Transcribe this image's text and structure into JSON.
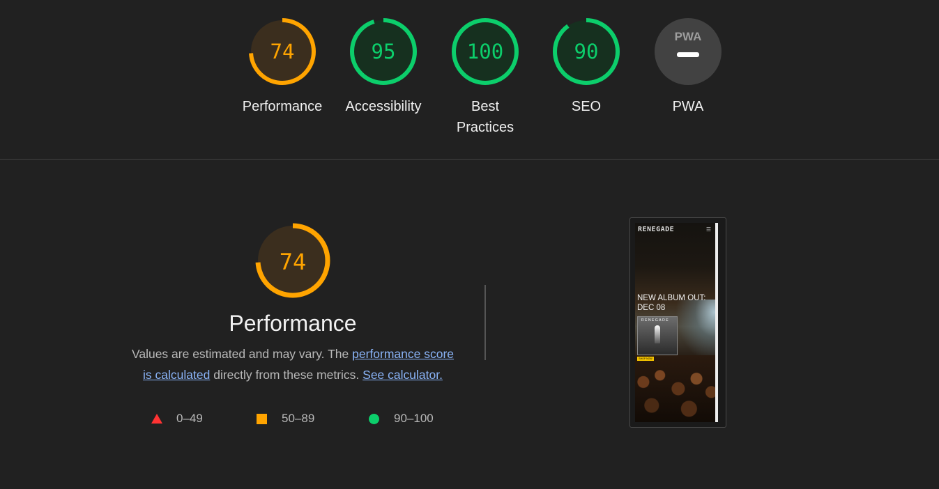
{
  "scores": [
    {
      "id": "performance",
      "value": 74,
      "text": "74",
      "label": "Performance",
      "color": "#ffa400",
      "fraction": 0.74
    },
    {
      "id": "accessibility",
      "value": 95,
      "text": "95",
      "label": "Accessibility",
      "color": "#0cce6b",
      "fraction": 0.95
    },
    {
      "id": "best-practices",
      "value": 100,
      "text": "100",
      "label": "Best Practices",
      "label_line1": "Best",
      "label_line2": "Practices",
      "color": "#0cce6b",
      "fraction": 1.0
    },
    {
      "id": "seo",
      "value": 90,
      "text": "90",
      "label": "SEO",
      "color": "#0cce6b",
      "fraction": 0.9
    },
    {
      "id": "pwa",
      "value": null,
      "badge": "PWA",
      "label": "PWA",
      "color": "#9e9e9e"
    }
  ],
  "performance_section": {
    "score": 74,
    "score_text": "74",
    "fraction": 0.74,
    "title": "Performance",
    "desc_prefix": "Values are estimated and may vary. The ",
    "link1_line1": "performance score",
    "link1_line2": "is calculated",
    "desc_middle": " directly from these metrics. ",
    "link2": "See calculator."
  },
  "legend": [
    {
      "shape": "triangle",
      "color": "#ff3333",
      "range": "0–49"
    },
    {
      "shape": "square",
      "color": "#ffa400",
      "range": "50–89"
    },
    {
      "shape": "circle",
      "color": "#0cce6b",
      "range": "90–100"
    }
  ],
  "screenshot": {
    "logo": "RENEGADE",
    "menu_icon": "hamburger-icon",
    "headline_line1": "NEW ALBUM OUT:",
    "headline_line2": "DEC 08",
    "album_text": "RENEGADE",
    "button_text": "SHOP NOW"
  }
}
